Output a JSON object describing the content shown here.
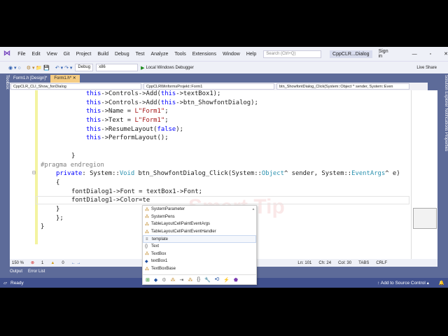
{
  "menu": [
    "File",
    "Edit",
    "View",
    "Git",
    "Project",
    "Build",
    "Debug",
    "Test",
    "Analyze",
    "Tools",
    "Extensions",
    "Window",
    "Help"
  ],
  "search_placeholder": "Search (Ctrl+Q)",
  "solution_name": "CppCLR...Dialog",
  "sign_in": "Sign in",
  "toolbar": {
    "config": "Debug",
    "platform": "x86",
    "run": "Local Windows Debugger",
    "live_share": "Live Share"
  },
  "tabs": [
    {
      "label": "Form1.h [Design]*"
    },
    {
      "label": "Form1.h*"
    }
  ],
  "side_left": "Toolbox",
  "side_right": "Solution Explorer   Notifications   Properties",
  "navbar": [
    "CppCLR_CLI_Show_fonDialog",
    "CppCLRWinformsProjekt::Form1",
    "btn_ShowfontDialog_Click(System::Object ^ sender, System::Even"
  ],
  "watermark": "Smart Tip",
  "code": {
    "l1": [
      "this",
      "->Controls->Add(",
      "this",
      "->textBox1);"
    ],
    "l2": [
      "this",
      "->Controls->Add(",
      "this",
      "->btn_ShowfontDialog);"
    ],
    "l3": [
      "this",
      "->Name = ",
      "L\"Form1\"",
      ";"
    ],
    "l4": [
      "this",
      "->Text = ",
      "L\"Form1\"",
      ";"
    ],
    "l5": [
      "this",
      "->ResumeLayout(",
      "false",
      ");"
    ],
    "l6": [
      "this",
      "->PerformLayout();"
    ],
    "l7": "}",
    "l8": "#pragma endregion",
    "l9": [
      "private",
      ": System::",
      "Void",
      " btn_ShowfontDialog_Click(System::",
      "Object",
      "^ sender, System::",
      "EventArgs",
      "^ e)"
    ],
    "l10": "{",
    "l11": "fontDialog1->Font = textBox1->Font;",
    "l12": "fontDialog1->Color=te",
    "l13": "}",
    "l14": "};",
    "l15": "}"
  },
  "completion": [
    {
      "label": "SystemParameter",
      "icon": "⁂"
    },
    {
      "label": "SystemPens",
      "icon": "⁂"
    },
    {
      "label": "TableLayoutCellPaintEventArgs",
      "icon": "⁂"
    },
    {
      "label": "TableLayoutCellPaintEventHandler",
      "icon": "⁂"
    },
    {
      "label": "template",
      "icon": "≡"
    },
    {
      "label": "Text",
      "icon": "{}"
    },
    {
      "label": "TextBox",
      "icon": "⁂"
    },
    {
      "label": "textBox1",
      "icon": "◆"
    },
    {
      "label": "TextBoxBase",
      "icon": "⁂"
    }
  ],
  "completion_filters": [
    "⊞",
    "◆",
    "⚙",
    "⁂",
    "⇥",
    "⁂",
    "{}",
    "🔧",
    "•0",
    "⚡",
    "⬟"
  ],
  "editor_status": {
    "zoom": "150 %",
    "errors": "1",
    "warnings": "0",
    "ln": "Ln: 101",
    "ch": "Ch: 24",
    "col": "Col: 30",
    "tabs": "TABS",
    "eol": "CRLF"
  },
  "bottom_tabs": [
    "Output",
    "Error List"
  ],
  "status": {
    "ready": "Ready",
    "source_control": "Add to Source Control"
  }
}
